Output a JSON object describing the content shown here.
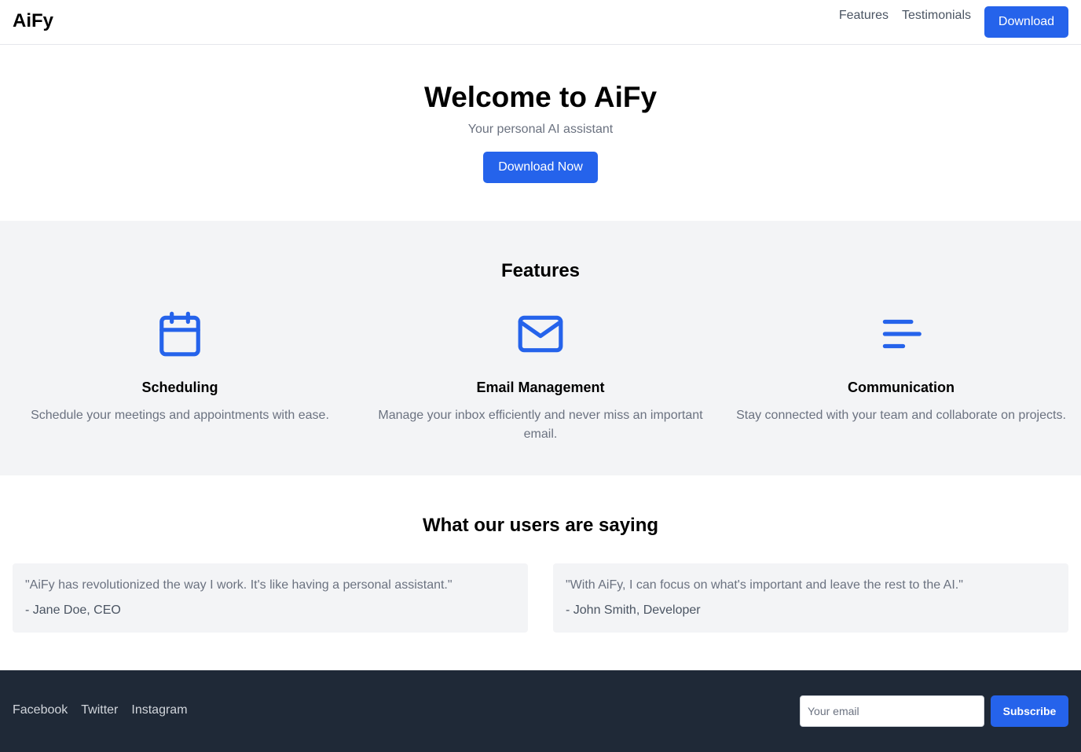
{
  "header": {
    "logo": "AiFy",
    "nav": [
      "Features",
      "Testimonials"
    ],
    "download_label": "Download"
  },
  "hero": {
    "title": "Welcome to AiFy",
    "subtitle": "Your personal AI assistant",
    "cta_label": "Download Now"
  },
  "features": {
    "heading": "Features",
    "accent_color": "#2563eb",
    "items": [
      {
        "icon": "calendar-icon",
        "title": "Scheduling",
        "description": "Schedule your meetings and appointments with ease."
      },
      {
        "icon": "mail-icon",
        "title": "Email Management",
        "description": "Manage your inbox efficiently and never miss an important email."
      },
      {
        "icon": "menu-lines-icon",
        "title": "Communication",
        "description": "Stay connected with your team and collaborate on projects."
      }
    ]
  },
  "testimonials": {
    "heading": "What our users are saying",
    "items": [
      {
        "quote": "\"AiFy has revolutionized the way I work. It's like having a personal assistant.\"",
        "author": "- Jane Doe, CEO"
      },
      {
        "quote": "\"With AiFy, I can focus on what's important and leave the rest to the AI.\"",
        "author": "- John Smith, Developer"
      }
    ]
  },
  "footer": {
    "social": [
      "Facebook",
      "Twitter",
      "Instagram"
    ],
    "email_placeholder": "Your email",
    "subscribe_label": "Subscribe"
  }
}
